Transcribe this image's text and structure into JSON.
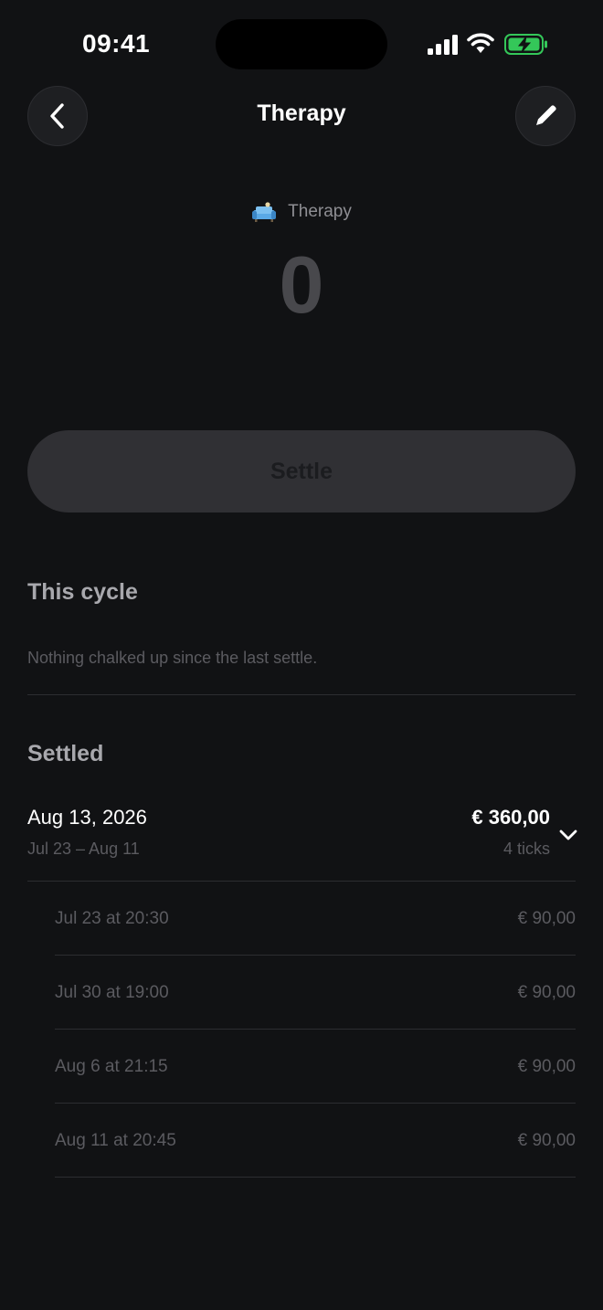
{
  "status": {
    "time": "09:41"
  },
  "header": {
    "title": "Therapy"
  },
  "tally": {
    "emoji": "🛋️",
    "name": "Therapy",
    "count": "0"
  },
  "settle_button": {
    "label": "Settle"
  },
  "this_cycle": {
    "title": "This cycle",
    "empty_text": "Nothing chalked up since the last settle."
  },
  "settled": {
    "title": "Settled",
    "groups": [
      {
        "date": "Aug 13, 2026",
        "range": "Jul 23 – Aug 11",
        "amount": "€ 360,00",
        "ticks": "4 ticks",
        "entries": [
          {
            "date": "Jul 23 at 20:30",
            "amount": "€ 90,00"
          },
          {
            "date": "Jul 30 at 19:00",
            "amount": "€ 90,00"
          },
          {
            "date": "Aug 6 at 21:15",
            "amount": "€ 90,00"
          },
          {
            "date": "Aug 11 at 20:45",
            "amount": "€ 90,00"
          }
        ]
      }
    ]
  },
  "colors": {
    "background": "#111214",
    "battery": "#34c759",
    "muted_text": "#5b5b60"
  },
  "icons": [
    "back-chevron-icon",
    "pencil-icon",
    "couch-icon",
    "chevron-down-icon",
    "signal-icon",
    "wifi-icon",
    "battery-icon"
  ]
}
